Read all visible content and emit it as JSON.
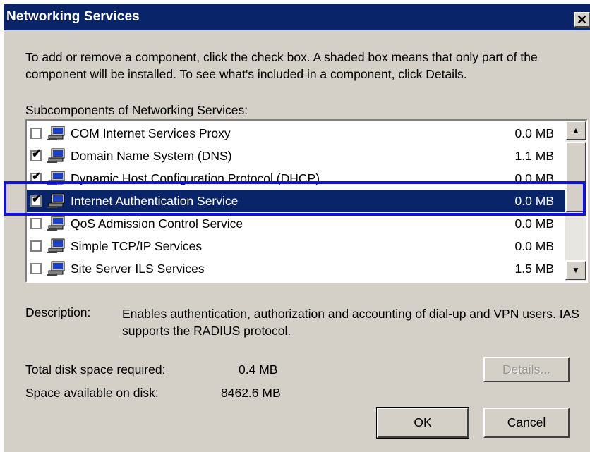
{
  "dialog": {
    "title": "Networking Services",
    "close_glyph": "✕",
    "instructions": "To add or remove a component, click the check box. A shaded box means that only part of the component will be installed. To see what's included in a component, click Details.",
    "subcomponents_label": "Subcomponents of Networking Services:",
    "items": [
      {
        "name": "COM Internet Services Proxy",
        "size": "0.0 MB",
        "checked": false
      },
      {
        "name": "Domain Name System (DNS)",
        "size": "1.1 MB",
        "checked": true
      },
      {
        "name": "Dynamic Host Configuration Protocol (DHCP)",
        "size": "0.0 MB",
        "checked": true
      },
      {
        "name": "Internet Authentication Service",
        "size": "0.0 MB",
        "checked": true,
        "selected": true
      },
      {
        "name": "QoS Admission Control Service",
        "size": "0.0 MB",
        "checked": false
      },
      {
        "name": "Simple TCP/IP Services",
        "size": "0.0 MB",
        "checked": false
      },
      {
        "name": "Site Server ILS Services",
        "size": "1.5 MB",
        "checked": false
      }
    ],
    "description_label": "Description:",
    "description_text": "Enables authentication, authorization and accounting of dial-up and VPN users. IAS supports the RADIUS protocol.",
    "total_disk_label": "Total disk space required:",
    "total_disk_value": "0.4 MB",
    "available_disk_label": "Space available on disk:",
    "available_disk_value": "8462.6 MB",
    "details_button": "Details...",
    "ok_button": "OK",
    "cancel_button": "Cancel"
  },
  "colors": {
    "title_bar": "#0a246a",
    "selection": "#0a246a",
    "face": "#d4d0c8",
    "highlight_box": "#1010e0"
  },
  "icons": {
    "item_icon": "computer-network-icon",
    "scroll_up": "up-arrow-icon",
    "scroll_down": "down-arrow-icon"
  }
}
